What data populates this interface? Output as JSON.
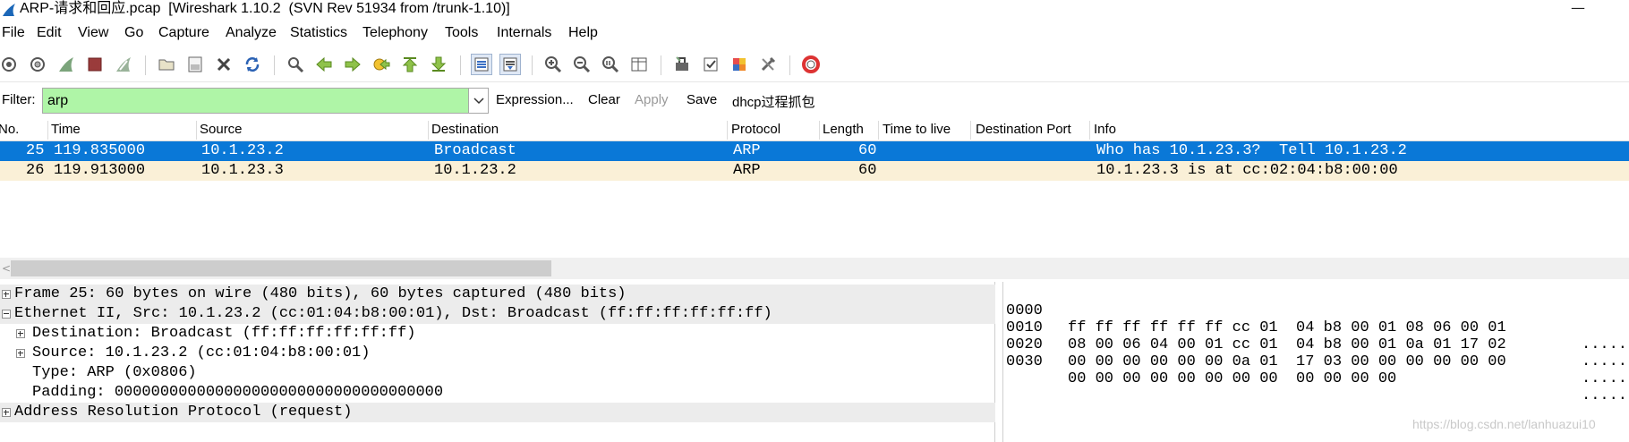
{
  "window": {
    "title": "ARP-请求和回应.pcap  [Wireshark 1.10.2  (SVN Rev 51934 from /trunk-1.10)]",
    "minimize_glyph": "—"
  },
  "menu": [
    "File",
    "Edit",
    "View",
    "Go",
    "Capture",
    "Analyze",
    "Statistics",
    "Telephony",
    "Tools",
    "Internals",
    "Help"
  ],
  "toolbar_icons": [
    "interfaces-icon",
    "options-icon",
    "start-capture-icon",
    "stop-capture-icon",
    "restart-capture-icon",
    "open-file-icon",
    "save-file-icon",
    "close-file-icon",
    "reload-icon",
    "find-packet-icon",
    "go-back-icon",
    "go-forward-icon",
    "go-to-packet-icon",
    "go-first-icon",
    "go-last-icon",
    "colorize-icon",
    "autoscroll-icon",
    "zoom-in-icon",
    "zoom-out-icon",
    "zoom-normal-icon",
    "resize-columns-icon",
    "capture-filters-icon",
    "display-filters-icon",
    "coloring-rules-icon",
    "preferences-icon",
    "help-icon"
  ],
  "filter": {
    "label": "Filter:",
    "value": "arp",
    "expression": "Expression...",
    "clear": "Clear",
    "apply": "Apply",
    "save": "Save",
    "saved_filter": "dhcp过程抓包"
  },
  "packet_list": {
    "columns": [
      "No.",
      "Time",
      "Source",
      "Destination",
      "Protocol",
      "Length",
      "Time to live",
      "Destination Port",
      "Info"
    ],
    "rows": [
      {
        "no": "25",
        "time": "119.835000",
        "source": "10.1.23.2",
        "destination": "Broadcast",
        "protocol": "ARP",
        "length": "60",
        "ttl": "",
        "dport": "",
        "info": "Who has 10.1.23.3?  Tell 10.1.23.2",
        "selected": true
      },
      {
        "no": "26",
        "time": "119.913000",
        "source": "10.1.23.3",
        "destination": "10.1.23.2",
        "protocol": "ARP",
        "length": "60",
        "ttl": "",
        "dport": "",
        "info": "10.1.23.3 is at cc:02:04:b8:00:00",
        "selected": false
      }
    ]
  },
  "details": [
    {
      "text": "Frame 25: 60 bytes on wire (480 bits), 60 bytes captured (480 bits)",
      "expander": "plus",
      "indent": 0,
      "grey": true
    },
    {
      "text": "Ethernet II, Src: 10.1.23.2 (cc:01:04:b8:00:01), Dst: Broadcast (ff:ff:ff:ff:ff:ff)",
      "expander": "minus",
      "indent": 0,
      "grey": true
    },
    {
      "text": "Destination: Broadcast (ff:ff:ff:ff:ff:ff)",
      "expander": "plus",
      "indent": 1,
      "grey": false
    },
    {
      "text": "Source: 10.1.23.2 (cc:01:04:b8:00:01)",
      "expander": "plus",
      "indent": 1,
      "grey": false
    },
    {
      "text": "Type: ARP (0x0806)",
      "expander": "none",
      "indent": 1,
      "grey": false
    },
    {
      "text": "Padding: 000000000000000000000000000000000000",
      "expander": "none",
      "indent": 1,
      "grey": false
    },
    {
      "text": "Address Resolution Protocol (request)",
      "expander": "plus",
      "indent": 0,
      "grey": true
    }
  ],
  "bytes": [
    {
      "offset": "0000",
      "hex": "ff ff ff ff ff ff cc 01  04 b8 00 01 08 06 00 01",
      "ascii": "......"
    },
    {
      "offset": "0010",
      "hex": "08 00 06 04 00 01 cc 01  04 b8 00 01 0a 01 17 02",
      "ascii": "......"
    },
    {
      "offset": "0020",
      "hex": "00 00 00 00 00 00 0a 01  17 03 00 00 00 00 00 00",
      "ascii": "......"
    },
    {
      "offset": "0030",
      "hex": "00 00 00 00 00 00 00 00  00 00 00 00",
      "ascii": "......"
    }
  ],
  "watermark": "https://blog.csdn.net/lanhuazui10"
}
